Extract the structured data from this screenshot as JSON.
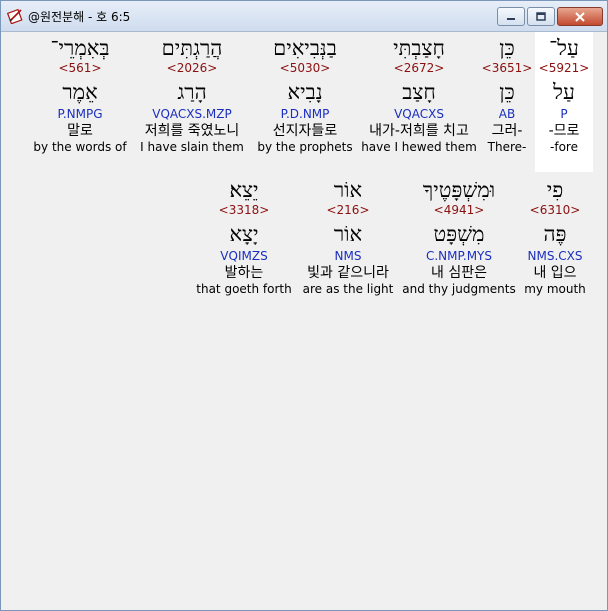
{
  "window": {
    "title": "@원전분해 - 호 6:5"
  },
  "colors": {
    "strong": "#8b1010",
    "morph": "#1a2ec0",
    "highlight": "#ffffff"
  },
  "icons": {
    "app": "bible-pen-icon",
    "minimize": "minimize-icon",
    "maximize": "maximize-icon",
    "close": "close-icon"
  },
  "rows": [
    {
      "words": [
        {
          "hebrew": "עַל־",
          "strong": "<5921>",
          "lemma": "עַל",
          "morph": "P",
          "korean": "-므로",
          "english": "-fore",
          "highlighted": true
        },
        {
          "hebrew": "כֵּן",
          "strong": "<3651>",
          "lemma": "כֵּן",
          "morph": "AB",
          "korean": "그러-",
          "english": "There-",
          "highlighted": false
        },
        {
          "hebrew": "חָצַבְתִּי",
          "strong": "<2672>",
          "lemma": "חָצַב",
          "morph": "VQACXS",
          "korean": "내가-저희를 치고",
          "english": "have I hewed them",
          "highlighted": false
        },
        {
          "hebrew": "בַנְּבִיאִים",
          "strong": "<5030>",
          "lemma": "נָבִיא",
          "morph": "P.D.NMP",
          "korean": "선지자들로",
          "english": "by the prophets",
          "highlighted": false
        },
        {
          "hebrew": "הֲרַגְתִּים",
          "strong": "<2026>",
          "lemma": "הָרַג",
          "morph": "VQACXS.MZP",
          "korean": "저희를 죽였노니",
          "english": "I have slain them",
          "highlighted": false
        },
        {
          "hebrew": "בְּאִמְרֵי־",
          "strong": "<561>",
          "lemma": "אֵמֶר",
          "morph": "P.NMPG",
          "korean": "말로",
          "english": "by the words of",
          "highlighted": false
        }
      ]
    },
    {
      "words": [
        {
          "hebrew": "פִי",
          "strong": "<6310>",
          "lemma": "פֶּה",
          "morph": "NMS.CXS",
          "korean": "내 입으",
          "english": "my mouth",
          "highlighted": false
        },
        {
          "hebrew": "וּמִשְׁפָּטֶיךָ",
          "strong": "<4941>",
          "lemma": "מִשְׁפָּט",
          "morph": "C.NMP.MYS",
          "korean": "내 심판은",
          "english": "and thy judgments",
          "highlighted": false
        },
        {
          "hebrew": "אוֹר",
          "strong": "<216>",
          "lemma": "אוֹר",
          "morph": "NMS",
          "korean": "빛과 같으니라",
          "english": "are as the light",
          "highlighted": false
        },
        {
          "hebrew": "יֵצֵא׃",
          "strong": "<3318>",
          "lemma": "יָצָא",
          "morph": "VQIMZS",
          "korean": "발하는",
          "english": "that goeth forth",
          "highlighted": false
        }
      ]
    }
  ]
}
